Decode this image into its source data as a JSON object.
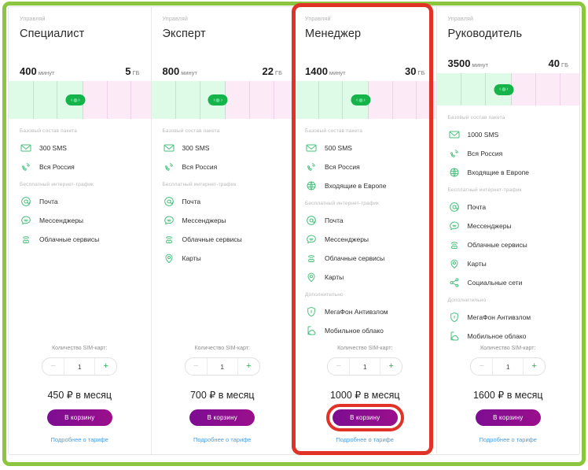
{
  "frame": {
    "accent_green": "#8cc63e",
    "highlight_red": "#e03226"
  },
  "labels": {
    "family": "Управляй",
    "unit_minutes": "минут",
    "unit_gb": "ГБ",
    "group_base": "Базовый состав пакета",
    "group_internet": "Бесплатный интернет-трафик",
    "group_extra": "Дополнительно",
    "sim_count": "Количество SIM-карт:",
    "price_suffix": "₽ в месяц",
    "cart_button": "В корзину",
    "details_link": "Подробнее о тарифе",
    "minus": "−",
    "plus": "+"
  },
  "cards": [
    {
      "name": "Специалист",
      "minutes": "400",
      "gb": "5",
      "slider_percent": 52,
      "knob_percent": 47,
      "base": [
        {
          "icon": "envelope-icon",
          "label": "300 SMS"
        },
        {
          "icon": "phone-signal-icon",
          "label": "Вся Россия"
        }
      ],
      "internet": [
        {
          "icon": "at-mail-icon",
          "label": "Почта"
        },
        {
          "icon": "chat-bubble-icon",
          "label": "Мессенджеры"
        },
        {
          "icon": "cloud-services-icon",
          "label": "Облачные сервисы"
        }
      ],
      "extra": [],
      "sim_value": "1",
      "price": "450",
      "highlighted": false
    },
    {
      "name": "Эксперт",
      "minutes": "800",
      "gb": "22",
      "slider_percent": 52,
      "knob_percent": 47,
      "base": [
        {
          "icon": "envelope-icon",
          "label": "300 SMS"
        },
        {
          "icon": "phone-signal-icon",
          "label": "Вся Россия"
        }
      ],
      "internet": [
        {
          "icon": "at-mail-icon",
          "label": "Почта"
        },
        {
          "icon": "chat-bubble-icon",
          "label": "Мессенджеры"
        },
        {
          "icon": "cloud-services-icon",
          "label": "Облачные сервисы"
        },
        {
          "icon": "map-pin-icon",
          "label": "Карты"
        }
      ],
      "extra": [],
      "sim_value": "1",
      "price": "700",
      "highlighted": false
    },
    {
      "name": "Менеджер",
      "minutes": "1400",
      "gb": "30",
      "slider_percent": 52,
      "knob_percent": 47,
      "base": [
        {
          "icon": "envelope-icon",
          "label": "500 SMS"
        },
        {
          "icon": "phone-signal-icon",
          "label": "Вся Россия"
        },
        {
          "icon": "globe-icon",
          "label": "Входящие в Европе"
        }
      ],
      "internet": [
        {
          "icon": "at-mail-icon",
          "label": "Почта"
        },
        {
          "icon": "chat-bubble-icon",
          "label": "Мессенджеры"
        },
        {
          "icon": "cloud-services-icon",
          "label": "Облачные сервисы"
        },
        {
          "icon": "map-pin-icon",
          "label": "Карты"
        }
      ],
      "extra": [
        {
          "icon": "shield-icon",
          "label": "МегаФон Антивзлом"
        },
        {
          "icon": "mobile-cloud-icon",
          "label": "Мобильное облако"
        }
      ],
      "sim_value": "1",
      "price": "1000",
      "highlighted": true
    },
    {
      "name": "Руководитель",
      "minutes": "3500",
      "gb": "40",
      "slider_percent": 52,
      "knob_percent": 47,
      "base": [
        {
          "icon": "envelope-icon",
          "label": "1000 SMS"
        },
        {
          "icon": "phone-signal-icon",
          "label": "Вся Россия"
        },
        {
          "icon": "globe-icon",
          "label": "Входящие в Европе"
        }
      ],
      "internet": [
        {
          "icon": "at-mail-icon",
          "label": "Почта"
        },
        {
          "icon": "chat-bubble-icon",
          "label": "Мессенджеры"
        },
        {
          "icon": "cloud-services-icon",
          "label": "Облачные сервисы"
        },
        {
          "icon": "map-pin-icon",
          "label": "Карты"
        },
        {
          "icon": "share-nodes-icon",
          "label": "Социальные сети"
        }
      ],
      "extra": [
        {
          "icon": "shield-icon",
          "label": "МегаФон Антивзлом"
        },
        {
          "icon": "mobile-cloud-icon",
          "label": "Мобильное облако"
        }
      ],
      "sim_value": "1",
      "price": "1600",
      "highlighted": false
    }
  ]
}
